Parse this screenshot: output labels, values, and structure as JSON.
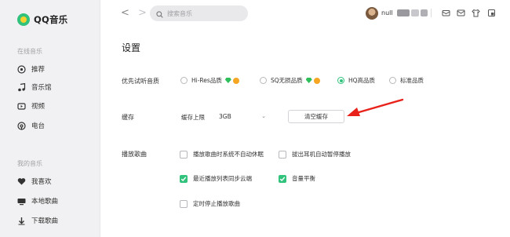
{
  "app": {
    "name": "QQ音乐",
    "accent": "#31c27c"
  },
  "sidebar": {
    "online_section": "在线音乐",
    "online_items": [
      {
        "label": "推荐",
        "icon": "recommend-icon"
      },
      {
        "label": "音乐馆",
        "icon": "music-hall-icon"
      },
      {
        "label": "视频",
        "icon": "video-icon"
      },
      {
        "label": "电台",
        "icon": "radio-icon"
      }
    ],
    "my_section": "我的音乐",
    "my_items": [
      {
        "label": "我喜欢",
        "icon": "heart-icon"
      },
      {
        "label": "本地歌曲",
        "icon": "local-songs-icon"
      },
      {
        "label": "下载歌曲",
        "icon": "download-icon"
      }
    ]
  },
  "topbar": {
    "back": "<",
    "forward": ">",
    "search_placeholder": "搜索音乐",
    "username": "null"
  },
  "settings": {
    "title": "设置",
    "quality": {
      "label": "优先试听音质",
      "options": [
        "Hi-Res品质",
        "SQ无损品质",
        "HQ高品质",
        "标准品质"
      ],
      "selected": "HQ高品质"
    },
    "cache": {
      "label": "缓存",
      "limit_label": "缓存上限",
      "limit_value": "3GB",
      "clear_button": "清空缓存"
    },
    "playback": {
      "label": "播放歌曲",
      "options": [
        {
          "label": "播放歌曲时系统不自动休眠",
          "checked": false
        },
        {
          "label": "拔出耳机自动暂停播放",
          "checked": false
        },
        {
          "label": "最近播放列表同步云端",
          "checked": true
        },
        {
          "label": "音量平衡",
          "checked": true
        },
        {
          "label": "定时停止播放歌曲",
          "checked": false
        }
      ]
    }
  }
}
